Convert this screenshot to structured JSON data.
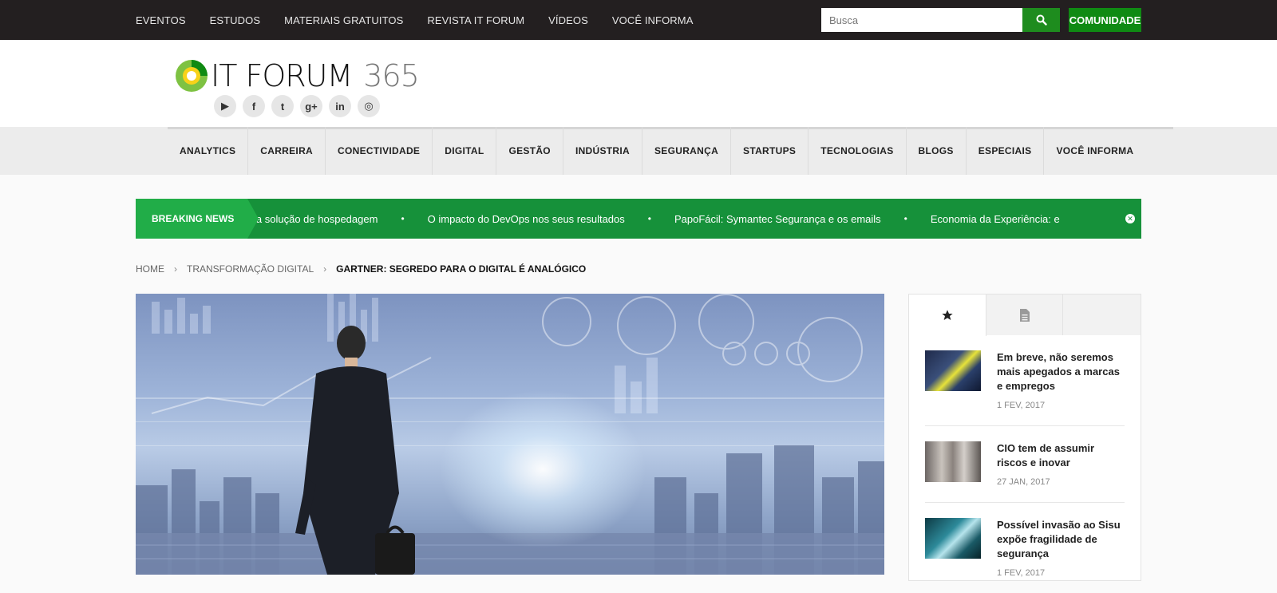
{
  "topbar": {
    "nav": [
      "EVENTOS",
      "ESTUDOS",
      "MATERIAIS GRATUITOS",
      "REVISTA IT FORUM",
      "VÍDEOS",
      "VOCÊ INFORMA"
    ],
    "search_placeholder": "Busca",
    "search_icon": "search-icon",
    "community_label": "COMUNIDADE"
  },
  "header": {
    "logo_text": "IT FORUM",
    "logo_number": "365",
    "social": [
      {
        "icon": "youtube-icon",
        "glyph": "▶"
      },
      {
        "icon": "facebook-icon",
        "glyph": "f"
      },
      {
        "icon": "twitter-icon",
        "glyph": "t"
      },
      {
        "icon": "google-plus-icon",
        "glyph": "g+"
      },
      {
        "icon": "linkedin-icon",
        "glyph": "in"
      },
      {
        "icon": "instagram-icon",
        "glyph": "◎"
      }
    ]
  },
  "main_nav": [
    "ANALYTICS",
    "CARREIRA",
    "CONECTIVIDADE",
    "DIGITAL",
    "GESTÃO",
    "INDÚSTRIA",
    "SEGURANÇA",
    "STARTUPS",
    "TECNOLOGIAS",
    "BLOGS",
    "ESPECIAIS",
    "VOCÊ INFORMA"
  ],
  "breaking": {
    "label": "BREAKING NEWS",
    "items": [
      "GoDaddy apresenta nova solução de hospedagem",
      "O impacto do DevOps nos seus resultados",
      "PapoFácil: Symantec Segurança e os emails",
      "Economia da Experiência: e"
    ],
    "separator": "•",
    "close_icon": "close-icon"
  },
  "breadcrumb": {
    "home": "HOME",
    "section": "TRANSFORMAÇÃO DIGITAL",
    "current": "GARTNER: SEGREDO PARA O DIGITAL É ANALÓGICO"
  },
  "sidebar": {
    "tabs": [
      {
        "icon": "star-icon"
      },
      {
        "icon": "document-icon"
      },
      {
        "icon": ""
      }
    ],
    "posts": [
      {
        "title": "Em breve, não seremos mais apegados a marcas e empregos",
        "date": "1 FEV, 2017"
      },
      {
        "title": "CIO tem de assumir riscos e inovar",
        "date": "27 JAN, 2017"
      },
      {
        "title": "Possível invasão ao Sisu expõe fragilidade de segurança",
        "date": "1 FEV, 2017"
      }
    ]
  },
  "colors": {
    "topbar": "#231f20",
    "green_button": "#0f8a13",
    "breaking_bg": "#16913a",
    "breaking_label": "#21ad48"
  }
}
